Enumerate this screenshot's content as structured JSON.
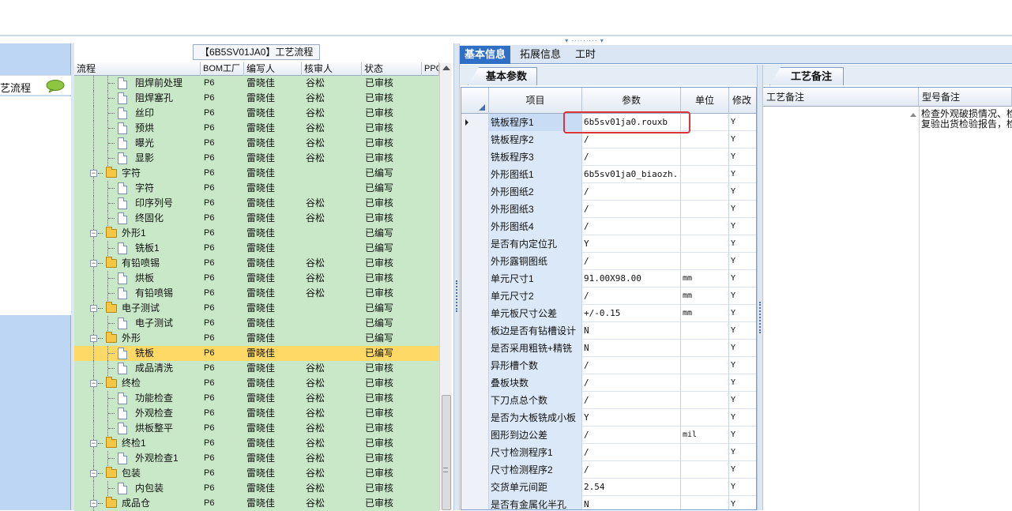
{
  "left_panel": {
    "item_label": "艺流程"
  },
  "tree": {
    "title": "【6B5SV01JA0】工艺流程",
    "headers": [
      "流程",
      "BOM工厂",
      "编写人",
      "核审人",
      "状态",
      "PPC"
    ],
    "rows": [
      {
        "name": "阻焊前处理",
        "type": "doc",
        "level": 2,
        "bom": "P6",
        "writer": "雷晓佳",
        "reviewer": "谷松",
        "status": "已审核"
      },
      {
        "name": "阻焊塞孔",
        "type": "doc",
        "level": 2,
        "bom": "P6",
        "writer": "雷晓佳",
        "reviewer": "谷松",
        "status": "已审核"
      },
      {
        "name": "丝印",
        "type": "doc",
        "level": 2,
        "bom": "P6",
        "writer": "雷晓佳",
        "reviewer": "谷松",
        "status": "已审核"
      },
      {
        "name": "预烘",
        "type": "doc",
        "level": 2,
        "bom": "P6",
        "writer": "雷晓佳",
        "reviewer": "谷松",
        "status": "已审核"
      },
      {
        "name": "曝光",
        "type": "doc",
        "level": 2,
        "bom": "P6",
        "writer": "雷晓佳",
        "reviewer": "谷松",
        "status": "已审核"
      },
      {
        "name": "显影",
        "type": "doc",
        "level": 2,
        "bom": "P6",
        "writer": "雷晓佳",
        "reviewer": "谷松",
        "status": "已审核"
      },
      {
        "name": "字符",
        "type": "folder",
        "level": 1,
        "bom": "P6",
        "writer": "雷晓佳",
        "reviewer": "",
        "status": "已编写"
      },
      {
        "name": "字符",
        "type": "doc",
        "level": 2,
        "bom": "P6",
        "writer": "雷晓佳",
        "reviewer": "",
        "status": "已编写"
      },
      {
        "name": "印序列号",
        "type": "doc",
        "level": 2,
        "bom": "P6",
        "writer": "雷晓佳",
        "reviewer": "谷松",
        "status": "已审核"
      },
      {
        "name": "终固化",
        "type": "doc",
        "level": 2,
        "bom": "P6",
        "writer": "雷晓佳",
        "reviewer": "谷松",
        "status": "已审核"
      },
      {
        "name": "外形1",
        "type": "folder",
        "level": 1,
        "bom": "P6",
        "writer": "雷晓佳",
        "reviewer": "",
        "status": "已编写"
      },
      {
        "name": "铣板1",
        "type": "doc",
        "level": 2,
        "bom": "P6",
        "writer": "雷晓佳",
        "reviewer": "",
        "status": "已编写"
      },
      {
        "name": "有铅喷锡",
        "type": "folder",
        "level": 1,
        "bom": "P6",
        "writer": "雷晓佳",
        "reviewer": "谷松",
        "status": "已审核"
      },
      {
        "name": "烘板",
        "type": "doc",
        "level": 2,
        "bom": "P6",
        "writer": "雷晓佳",
        "reviewer": "谷松",
        "status": "已审核"
      },
      {
        "name": "有铅喷锡",
        "type": "doc",
        "level": 2,
        "bom": "P6",
        "writer": "雷晓佳",
        "reviewer": "谷松",
        "status": "已审核"
      },
      {
        "name": "电子测试",
        "type": "folder",
        "level": 1,
        "bom": "P6",
        "writer": "雷晓佳",
        "reviewer": "",
        "status": "已编写"
      },
      {
        "name": "电子测试",
        "type": "doc",
        "level": 2,
        "bom": "P6",
        "writer": "雷晓佳",
        "reviewer": "",
        "status": "已编写"
      },
      {
        "name": "外形",
        "type": "folder",
        "level": 1,
        "bom": "P6",
        "writer": "雷晓佳",
        "reviewer": "",
        "status": "已编写"
      },
      {
        "name": "铣板",
        "type": "doc",
        "level": 2,
        "bom": "P6",
        "writer": "雷晓佳",
        "reviewer": "",
        "status": "已编写",
        "selected": true
      },
      {
        "name": "成品清洗",
        "type": "doc",
        "level": 2,
        "bom": "P6",
        "writer": "雷晓佳",
        "reviewer": "谷松",
        "status": "已审核"
      },
      {
        "name": "终检",
        "type": "folder",
        "level": 1,
        "bom": "P6",
        "writer": "雷晓佳",
        "reviewer": "谷松",
        "status": "已审核"
      },
      {
        "name": "功能检查",
        "type": "doc",
        "level": 2,
        "bom": "P6",
        "writer": "雷晓佳",
        "reviewer": "谷松",
        "status": "已审核"
      },
      {
        "name": "外观检查",
        "type": "doc",
        "level": 2,
        "bom": "P6",
        "writer": "雷晓佳",
        "reviewer": "谷松",
        "status": "已审核"
      },
      {
        "name": "烘板整平",
        "type": "doc",
        "level": 2,
        "bom": "P6",
        "writer": "雷晓佳",
        "reviewer": "谷松",
        "status": "已审核"
      },
      {
        "name": "终检1",
        "type": "folder",
        "level": 1,
        "bom": "P6",
        "writer": "雷晓佳",
        "reviewer": "谷松",
        "status": "已审核"
      },
      {
        "name": "外观检查1",
        "type": "doc",
        "level": 2,
        "bom": "P6",
        "writer": "雷晓佳",
        "reviewer": "谷松",
        "status": "已审核"
      },
      {
        "name": "包装",
        "type": "folder",
        "level": 1,
        "bom": "P6",
        "writer": "雷晓佳",
        "reviewer": "谷松",
        "status": "已审核"
      },
      {
        "name": "内包装",
        "type": "doc",
        "level": 2,
        "bom": "P6",
        "writer": "雷晓佳",
        "reviewer": "谷松",
        "status": "已审核"
      },
      {
        "name": "成品仓",
        "type": "folder",
        "level": 1,
        "bom": "P6",
        "writer": "雷晓佳",
        "reviewer": "谷松",
        "status": "已审核"
      }
    ]
  },
  "tabs": [
    "基本信息",
    "拓展信息",
    "工时"
  ],
  "subtab": "基本参数",
  "param_grid": {
    "headers": [
      "项目",
      "参数",
      "单位",
      "修改"
    ],
    "rows": [
      {
        "item": "铣板程序1",
        "param": "6b5sv01ja0.rouxb",
        "unit": "",
        "mod": "Y",
        "current": true
      },
      {
        "item": "铣板程序2",
        "param": "/",
        "unit": "",
        "mod": "Y"
      },
      {
        "item": "铣板程序3",
        "param": "/",
        "unit": "",
        "mod": "Y"
      },
      {
        "item": "外形图纸1",
        "param": "6b5sv01ja0_biaozh...",
        "unit": "",
        "mod": "Y"
      },
      {
        "item": "外形图纸2",
        "param": "/",
        "unit": "",
        "mod": "Y"
      },
      {
        "item": "外形图纸3",
        "param": "/",
        "unit": "",
        "mod": "Y"
      },
      {
        "item": "外形图纸4",
        "param": "/",
        "unit": "",
        "mod": "Y"
      },
      {
        "item": "是否有内定位孔",
        "param": "Y",
        "unit": "",
        "mod": "Y"
      },
      {
        "item": "外形露铜图纸",
        "param": "/",
        "unit": "",
        "mod": "Y"
      },
      {
        "item": "单元尺寸1",
        "param": "91.00X98.00",
        "unit": "mm",
        "mod": "Y"
      },
      {
        "item": "单元尺寸2",
        "param": "/",
        "unit": "mm",
        "mod": "Y"
      },
      {
        "item": "单元板尺寸公差",
        "param": "+/-0.15",
        "unit": "mm",
        "mod": "Y"
      },
      {
        "item": "板边是否有钻槽设计",
        "param": "N",
        "unit": "",
        "mod": "Y"
      },
      {
        "item": "是否采用粗铣+精铣",
        "param": "N",
        "unit": "",
        "mod": "Y"
      },
      {
        "item": "异形槽个数",
        "param": "/",
        "unit": "",
        "mod": "Y"
      },
      {
        "item": "叠板块数",
        "param": "/",
        "unit": "",
        "mod": "Y"
      },
      {
        "item": "下刀点总个数",
        "param": "/",
        "unit": "",
        "mod": "Y"
      },
      {
        "item": "是否为大板铣成小板",
        "param": "Y",
        "unit": "",
        "mod": "Y"
      },
      {
        "item": "图形到边公差",
        "param": "/",
        "unit": "mil",
        "mod": "Y"
      },
      {
        "item": "尺寸检测程序1",
        "param": "/",
        "unit": "",
        "mod": "Y"
      },
      {
        "item": "尺寸检测程序2",
        "param": "/",
        "unit": "",
        "mod": "Y"
      },
      {
        "item": "交货单元间距",
        "param": "2.54",
        "unit": "",
        "mod": "Y"
      },
      {
        "item": "是否有金属化半孔",
        "param": "N",
        "unit": "",
        "mod": "Y"
      }
    ]
  },
  "notes": {
    "tab": "工艺备注",
    "col1": "工艺备注",
    "col2": "型号备注",
    "text_line1": "检查外观破损情况、检",
    "text_line2": "复验出货检验报告，检"
  }
}
